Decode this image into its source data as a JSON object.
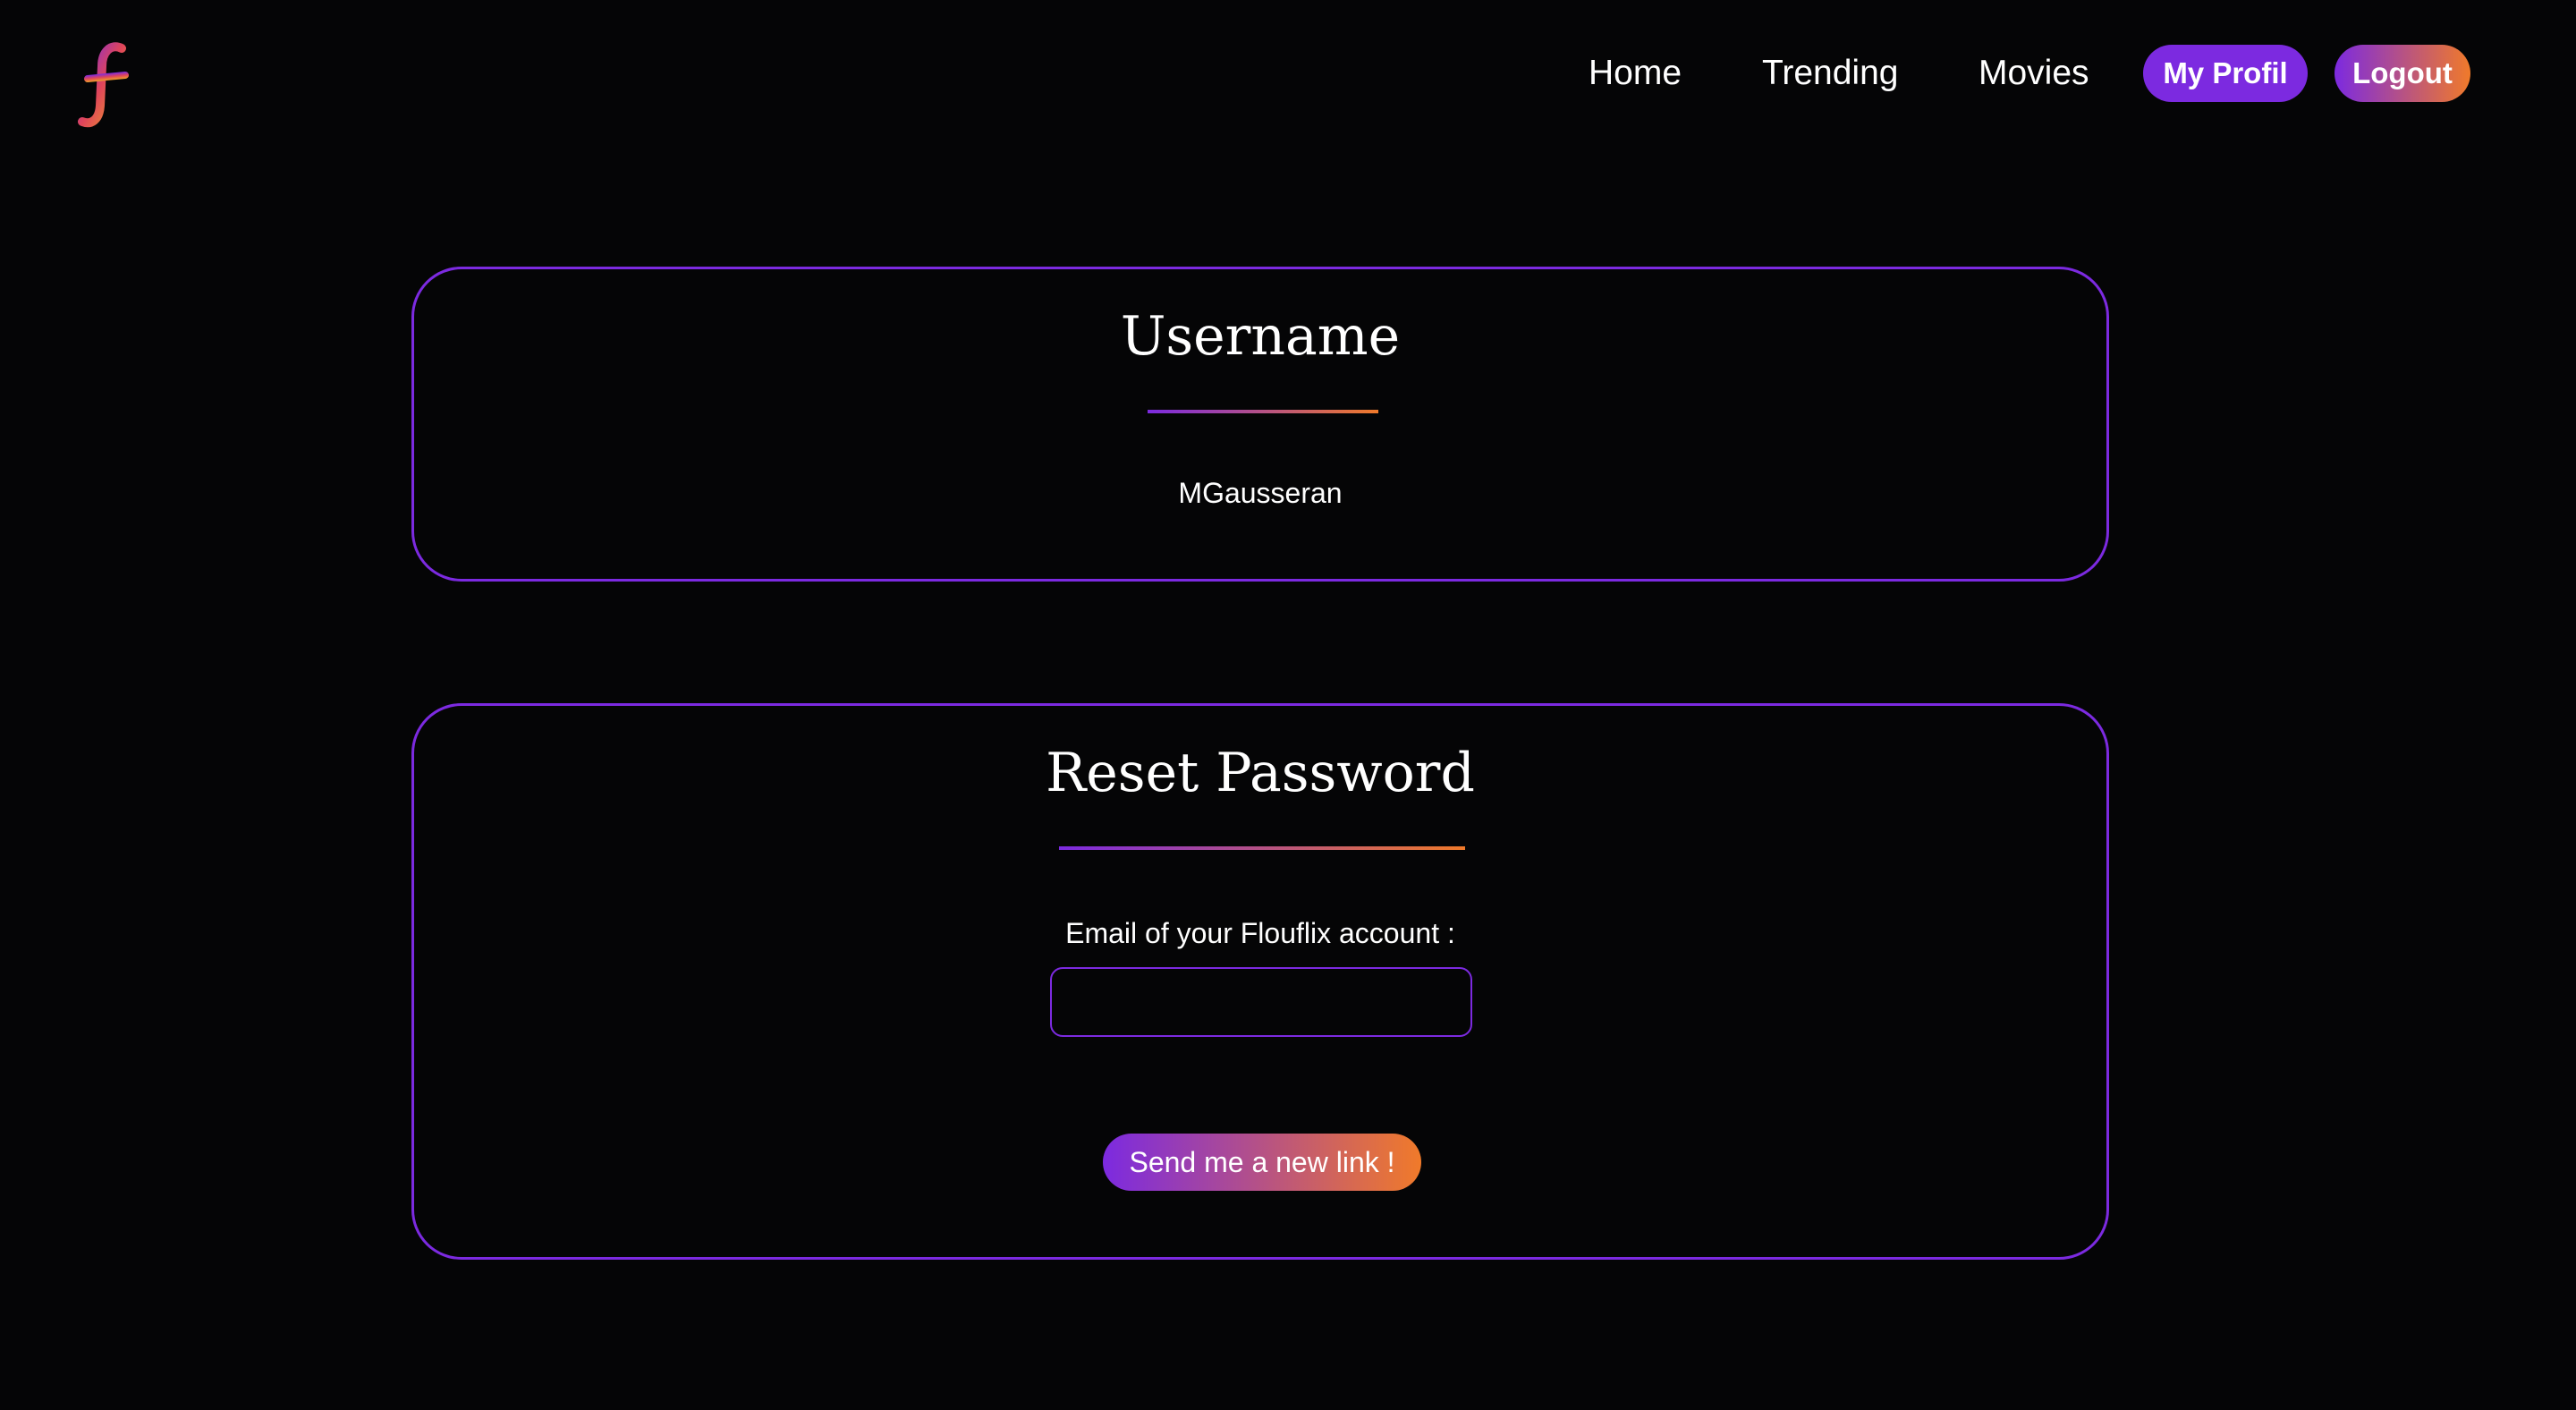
{
  "header": {
    "logo_icon": "flouflix-f-logo",
    "nav": {
      "home": "Home",
      "trending": "Trending",
      "movies": "Movies"
    },
    "my_profil_label": "My Profil",
    "logout_label": "Logout"
  },
  "username_card": {
    "title": "Username",
    "value": "MGausseran"
  },
  "reset_card": {
    "title": "Reset Password",
    "email_label": "Email of your Flouflix account :",
    "email_value": "",
    "submit_label": "Send me a new link !"
  },
  "colors": {
    "background": "#050506",
    "accent_purple": "#7c2ae0",
    "accent_orange": "#f07a2a",
    "text": "#ffffff"
  }
}
